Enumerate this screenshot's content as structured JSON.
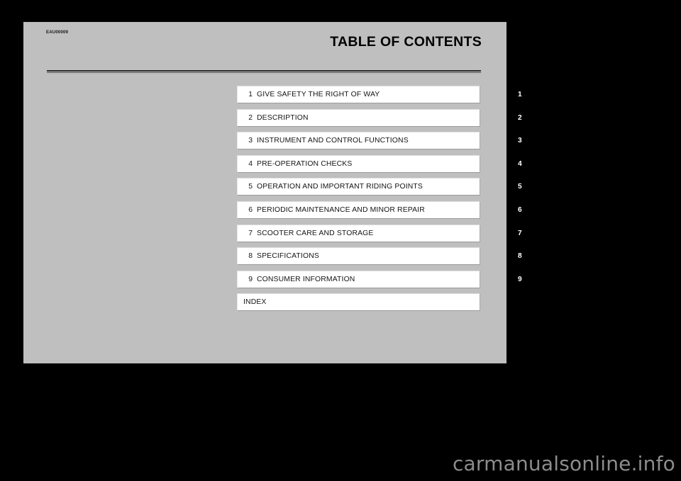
{
  "page": {
    "doc_code": "EAU00009",
    "title": "TABLE OF CONTENTS",
    "background_color": "#bfbfbf",
    "canvas_color": "#000000"
  },
  "contents": {
    "rows": [
      {
        "number": "1",
        "label": "GIVE SAFETY THE RIGHT OF WAY",
        "tab": "1"
      },
      {
        "number": "2",
        "label": "DESCRIPTION",
        "tab": "2"
      },
      {
        "number": "3",
        "label": "INSTRUMENT AND CONTROL FUNCTIONS",
        "tab": "3"
      },
      {
        "number": "4",
        "label": "PRE-OPERATION CHECKS",
        "tab": "4"
      },
      {
        "number": "5",
        "label": "OPERATION AND IMPORTANT RIDING POINTS",
        "tab": "5"
      },
      {
        "number": "6",
        "label": "PERIODIC MAINTENANCE AND MINOR REPAIR",
        "tab": "6"
      },
      {
        "number": "7",
        "label": "SCOOTER CARE AND STORAGE",
        "tab": "7"
      },
      {
        "number": "8",
        "label": "SPECIFICATIONS",
        "tab": "8"
      },
      {
        "number": "9",
        "label": "CONSUMER INFORMATION",
        "tab": "9"
      },
      {
        "number": "",
        "label": "INDEX",
        "tab": ""
      }
    ]
  },
  "watermark": {
    "text": "carmanualsonline.info",
    "color": "#8c8c8c"
  }
}
